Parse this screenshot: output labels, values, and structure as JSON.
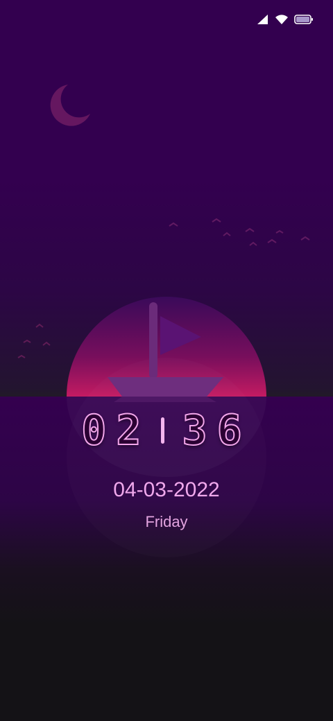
{
  "status_bar": {
    "icons": [
      "cellular-signal-icon",
      "wifi-icon",
      "battery-icon"
    ],
    "battery_level": 1.0
  },
  "wallpaper": {
    "elements": [
      "crescent-moon",
      "birds",
      "sun",
      "sailboat",
      "horizon"
    ]
  },
  "lockscreen": {
    "hours": "02",
    "minutes": "36",
    "date": "04-03-2022",
    "weekday": "Friday"
  },
  "colors": {
    "sky_top": "#33004f",
    "sun": "#c01a66",
    "boat": "#6a2c7a",
    "clock_outline": "#f2a6ea",
    "date_text": "#f0a8ec",
    "lower_bottom": "#141216"
  }
}
